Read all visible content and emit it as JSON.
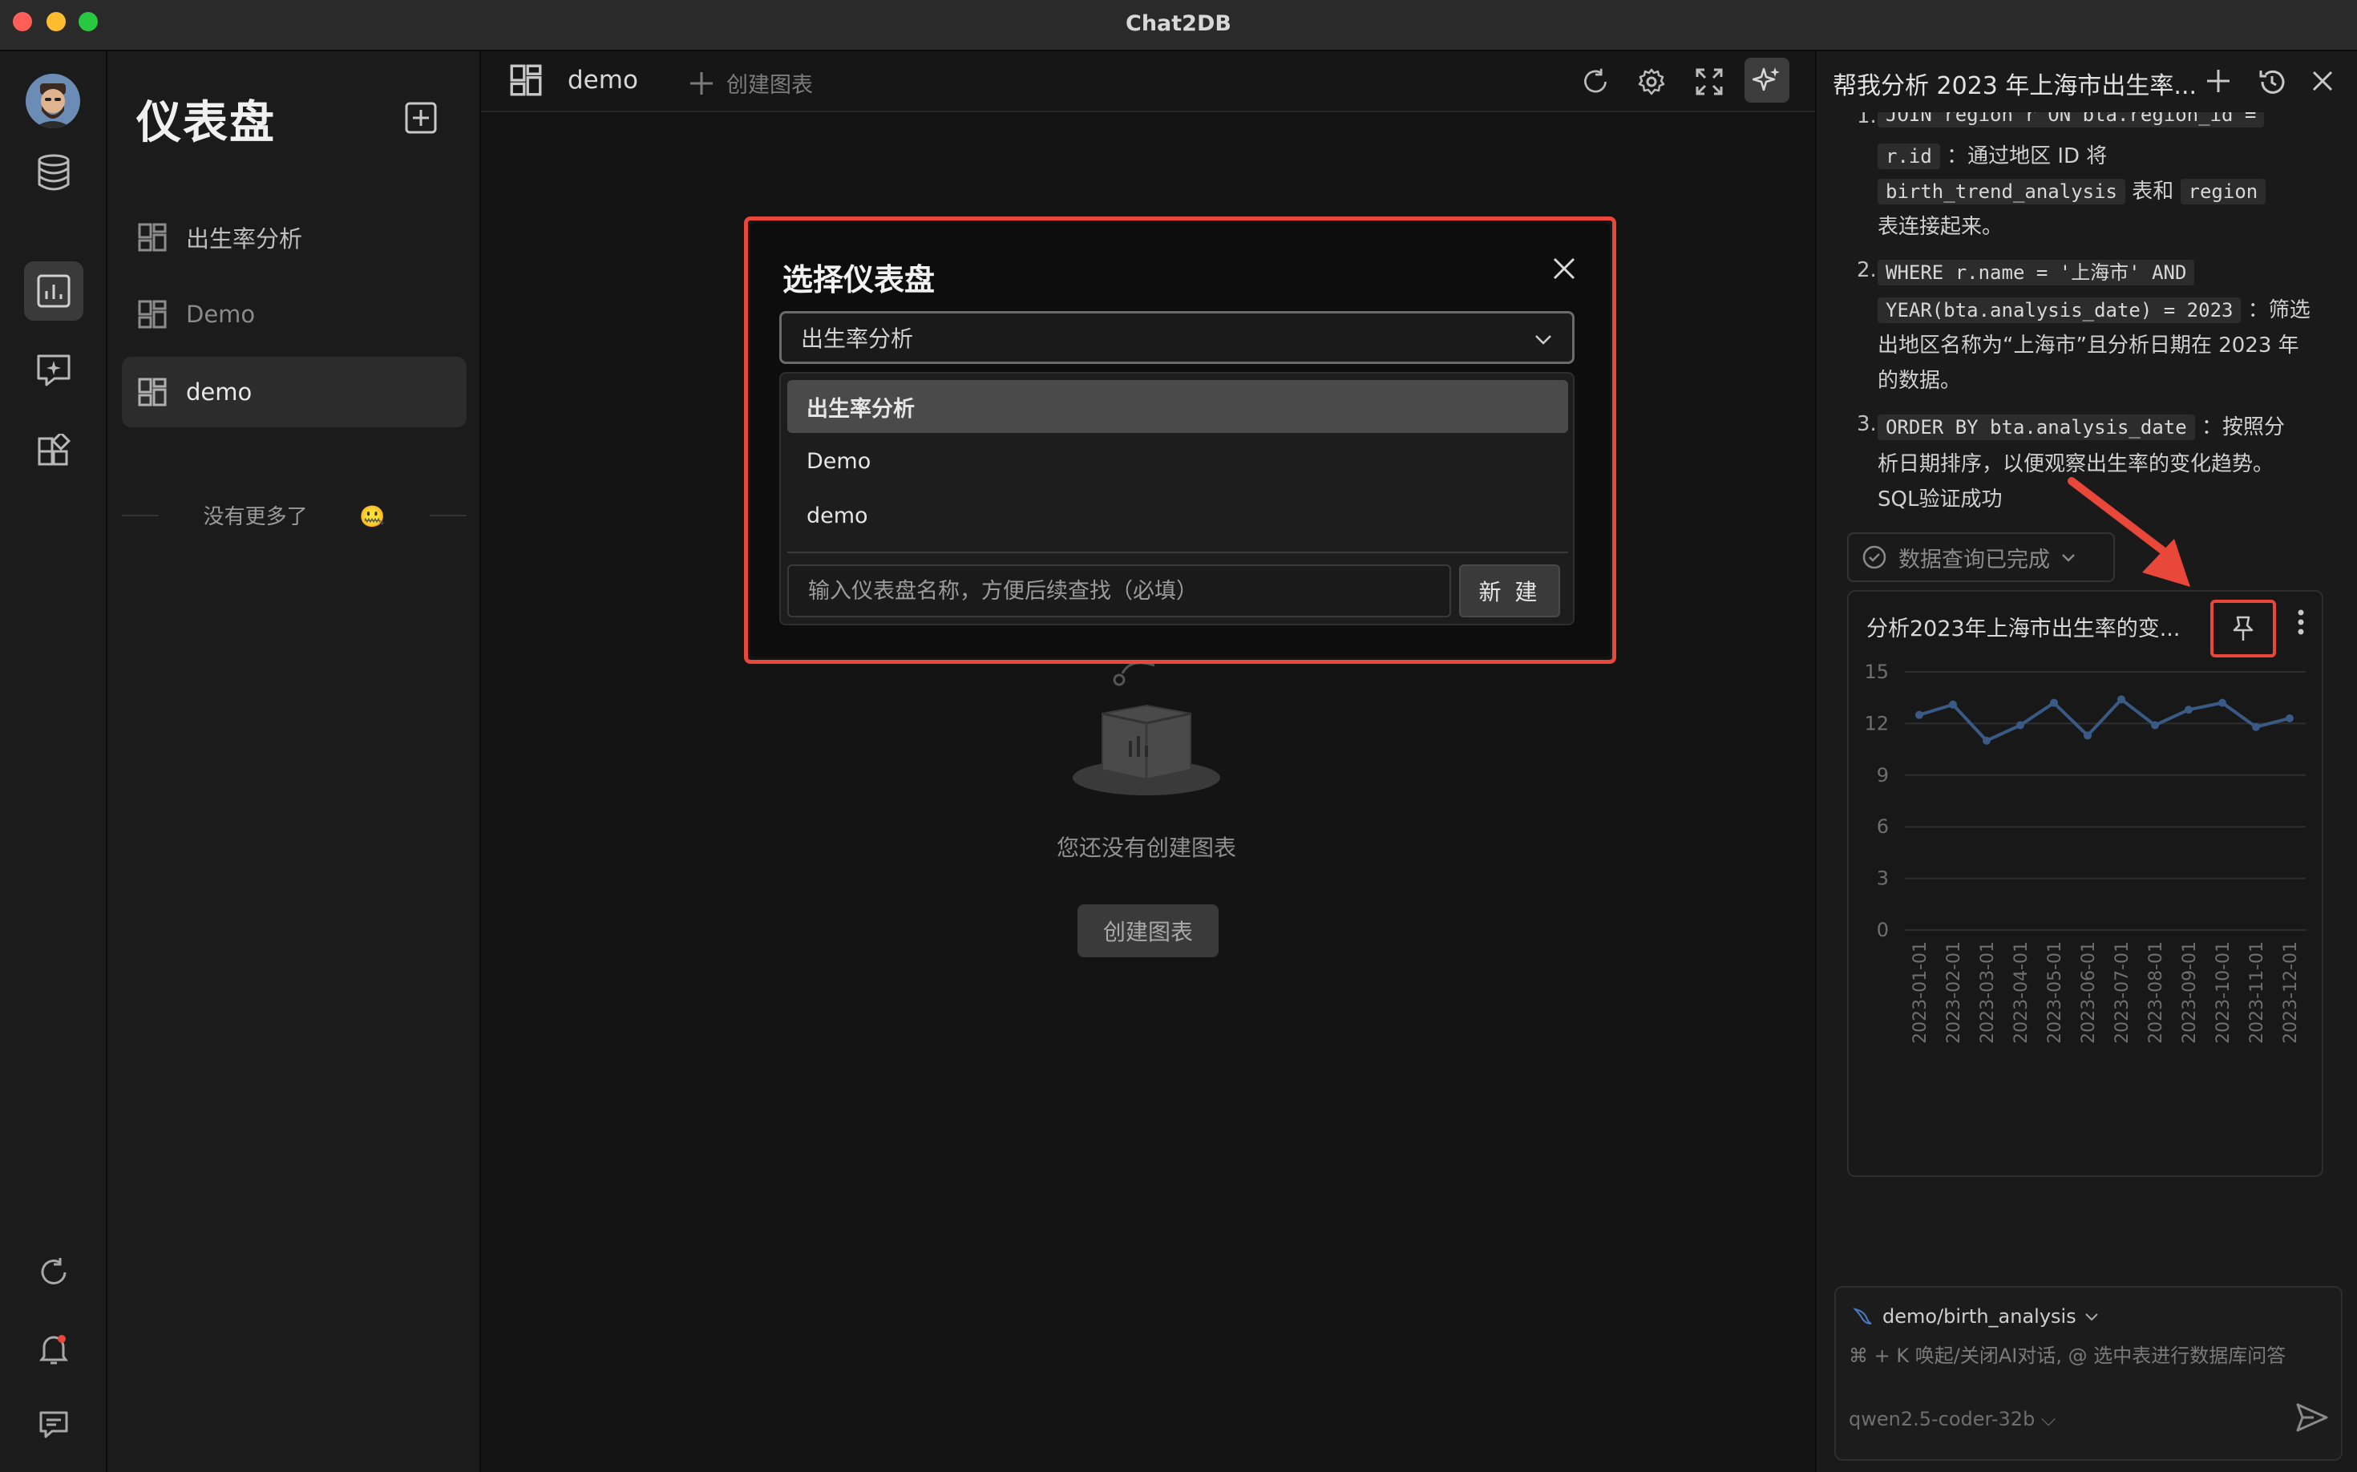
{
  "app": {
    "title": "Chat2DB"
  },
  "window_controls": {
    "close_color": "#ff5f57",
    "minimize_color": "#febc2e",
    "maximize_color": "#28c840"
  },
  "rail": {
    "items": [
      {
        "icon": "avatar"
      },
      {
        "icon": "database-icon"
      },
      {
        "icon": "dashboard-icon",
        "active": true
      },
      {
        "icon": "ai-chat-icon"
      },
      {
        "icon": "apps-icon"
      }
    ],
    "bottom": [
      {
        "icon": "refresh-icon"
      },
      {
        "icon": "bell-icon"
      },
      {
        "icon": "feedback-icon"
      }
    ]
  },
  "dashboards": {
    "title": "仪表盘",
    "items": [
      {
        "label": "出生率分析",
        "selected": false
      },
      {
        "label": "Demo",
        "selected": false
      },
      {
        "label": "demo",
        "selected": true
      }
    ],
    "no_more": "没有更多了",
    "no_more_emoji": "🤐"
  },
  "toolbar": {
    "tab_label": "demo",
    "add_chart_label": "创建图表"
  },
  "empty_state": {
    "text": "您还没有创建图表",
    "button": "创建图表"
  },
  "ai_panel": {
    "title": "帮我分析 2023 年上海市出生率...",
    "steps": [
      {
        "num": "1.",
        "code1": "JOIN region r ON bta.region_id =",
        "code2": "r.id",
        "text1": "：通过地区 ID 将",
        "code3": "birth_trend_analysis",
        "text2": "表和",
        "code4": "region",
        "text3": "表连接起来。"
      },
      {
        "num": "2.",
        "code1": "WHERE r.name = '上海市' AND",
        "code2": "YEAR(bta.analysis_date) = 2023",
        "text1": "：筛选",
        "text2": "出地区名称为“上海市”且分析日期在 2023 年",
        "text3": "的数据。"
      },
      {
        "num": "3.",
        "code1": "ORDER BY bta.analysis_date",
        "text1": "：按照分",
        "text2": "析日期排序，以便观察出生率的变化趋势。",
        "text3": "SQL验证成功"
      }
    ],
    "status_chip": "数据查询已完成",
    "chart_title": "分析2023年上海市出生率的变...",
    "input": {
      "db": "demo/birth_analysis",
      "placeholder": "⌘ + K 唤起/关闭AI对话, @ 选中表进行数据库问答",
      "model": "qwen2.5-coder-32b"
    }
  },
  "chart_data": {
    "type": "line",
    "x": [
      "2023-01-01",
      "2023-02-01",
      "2023-03-01",
      "2023-04-01",
      "2023-05-01",
      "2023-06-01",
      "2023-07-01",
      "2023-08-01",
      "2023-09-01",
      "2023-10-01",
      "2023-11-01",
      "2023-12-01"
    ],
    "series": [
      {
        "values": [
          12.5,
          13.1,
          11.0,
          11.9,
          13.2,
          11.3,
          13.4,
          11.9,
          12.8,
          13.2,
          11.8,
          12.3
        ]
      }
    ],
    "yticks": [
      "0",
      "3",
      "6",
      "9",
      "12",
      "15"
    ],
    "ylim": [
      0,
      15
    ],
    "grid": true,
    "color": "#3a5a86"
  },
  "modal": {
    "title": "选择仪表盘",
    "selected_value": "出生率分析",
    "options": [
      {
        "label": "出生率分析",
        "selected": true
      },
      {
        "label": "Demo",
        "selected": false
      },
      {
        "label": "demo",
        "selected": false
      }
    ],
    "new_placeholder": "输入仪表盘名称，方便后续查找（必填）",
    "new_button": "新 建"
  },
  "accent": {
    "highlight": "#e8473a"
  }
}
